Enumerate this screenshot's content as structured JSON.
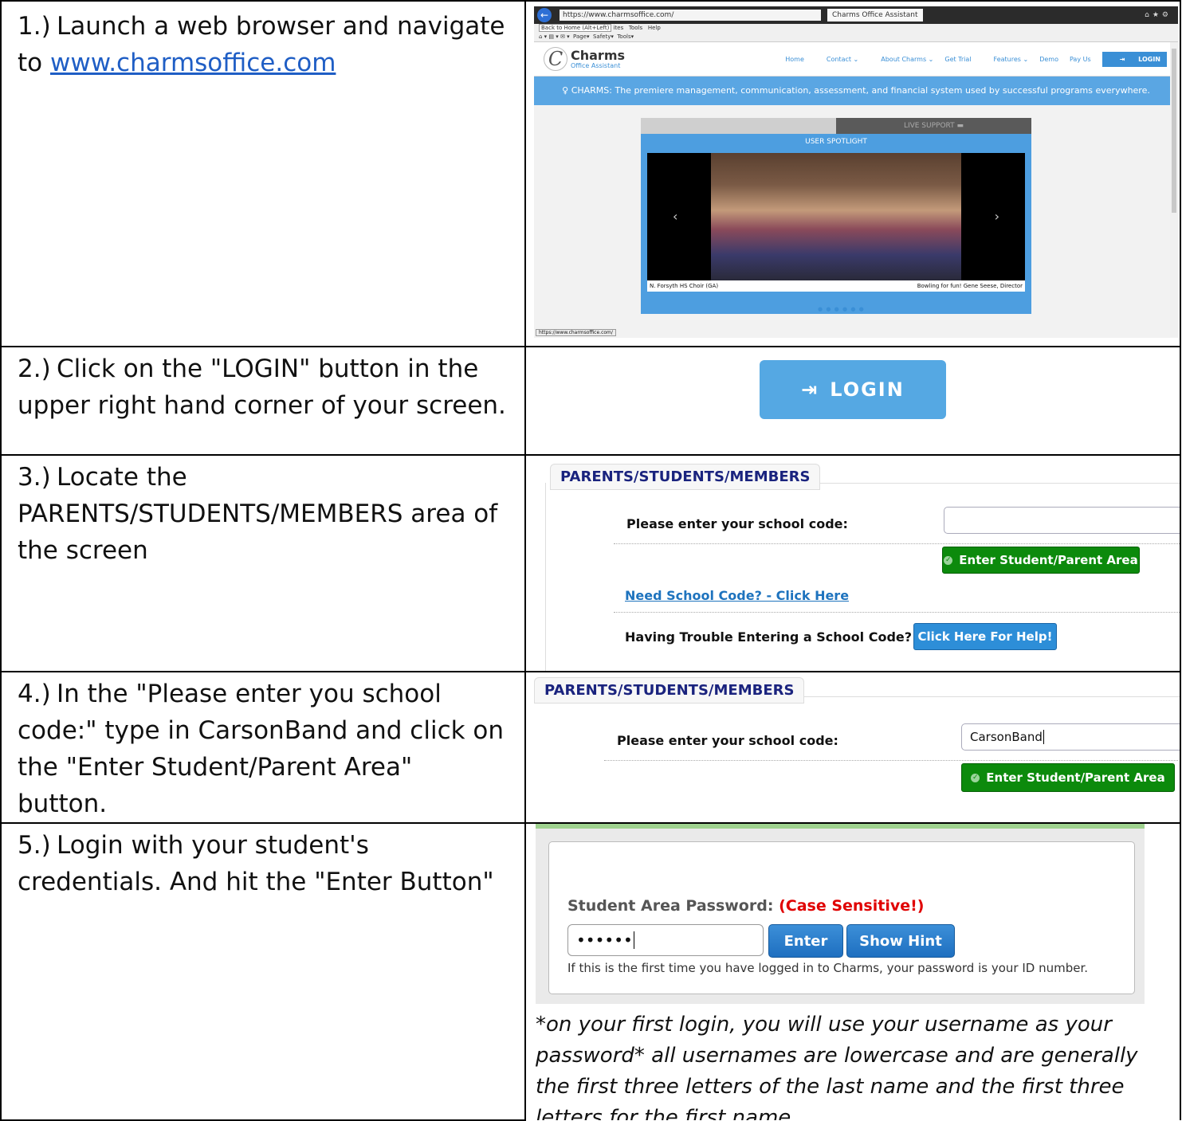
{
  "steps": [
    {
      "num": "1.)",
      "text_before": "Launch a web browser and navigate to ",
      "link": "www.charmsoffice.com"
    },
    {
      "num": "2.)",
      "text": "Click on the \"LOGIN\" button in the upper right hand corner of your screen."
    },
    {
      "num": "3.)",
      "text": "Locate the PARENTS/STUDENTS/MEMBERS area of the screen"
    },
    {
      "num": "4.)",
      "text": "In the \"Please enter you school code:\" type in CarsonBand and click on the \"Enter Student/Parent Area\" button."
    },
    {
      "num": "5.)",
      "text": "Login with your student's credentials.   And hit the \"Enter Button\""
    }
  ],
  "browser": {
    "address": "https://www.charmsoffice.com/",
    "tab": "Charms Office Assistant",
    "tooltip": "Back to Home (Alt+Left)",
    "menu_items": [
      "ites",
      "Tools",
      "Help"
    ],
    "toolbar_items": [
      "Page",
      "Safety",
      "Tools"
    ],
    "logo_title": "Charms",
    "logo_subtitle": "Office Assistant",
    "nav": [
      "Home",
      "Contact",
      "About Charms",
      "Get Trial",
      "Features",
      "Demo",
      "Pay Us"
    ],
    "login_label": "LOGIN",
    "banner": "CHARMS: The premiere management, communication, assessment, and financial system used by successful programs everywhere.",
    "live_support": "LIVE SUPPORT",
    "spotlight_title": "USER SPOTLIGHT",
    "caption_left": "N. Forsyth HS Choir (GA)",
    "caption_right": "Bowling for fun! Gene Seese, Director",
    "status_url": "https://www.charmsoffice.com/"
  },
  "login_button": {
    "label": "LOGIN"
  },
  "panel3": {
    "title": "PARENTS/STUDENTS/MEMBERS",
    "school_code_label": "Please enter your school code:",
    "school_code_value": "",
    "enter_button": "Enter Student/Parent Area",
    "need_code_link": "Need School Code? - Click Here",
    "trouble_label": "Having Trouble Entering a School Code?",
    "help_button": "Click Here For Help!"
  },
  "panel4": {
    "title": "PARENTS/STUDENTS/MEMBERS",
    "school_code_label": "Please enter your school code:",
    "school_code_value": "CarsonBand",
    "enter_button": "Enter Student/Parent Area"
  },
  "panel5": {
    "password_label": "Student Area Password:",
    "case_note": "(Case Sensitive!)",
    "password_value": "••••••",
    "enter_button": "Enter",
    "hint_button": "Show Hint",
    "note": "If this is the first time you have logged in to Charms, your password is your ID number.",
    "instructions": "*on your first login, you will use your username as your password*  all usernames are lowercase and are generally the first three letters of the last name and the first three letters for the first name."
  }
}
